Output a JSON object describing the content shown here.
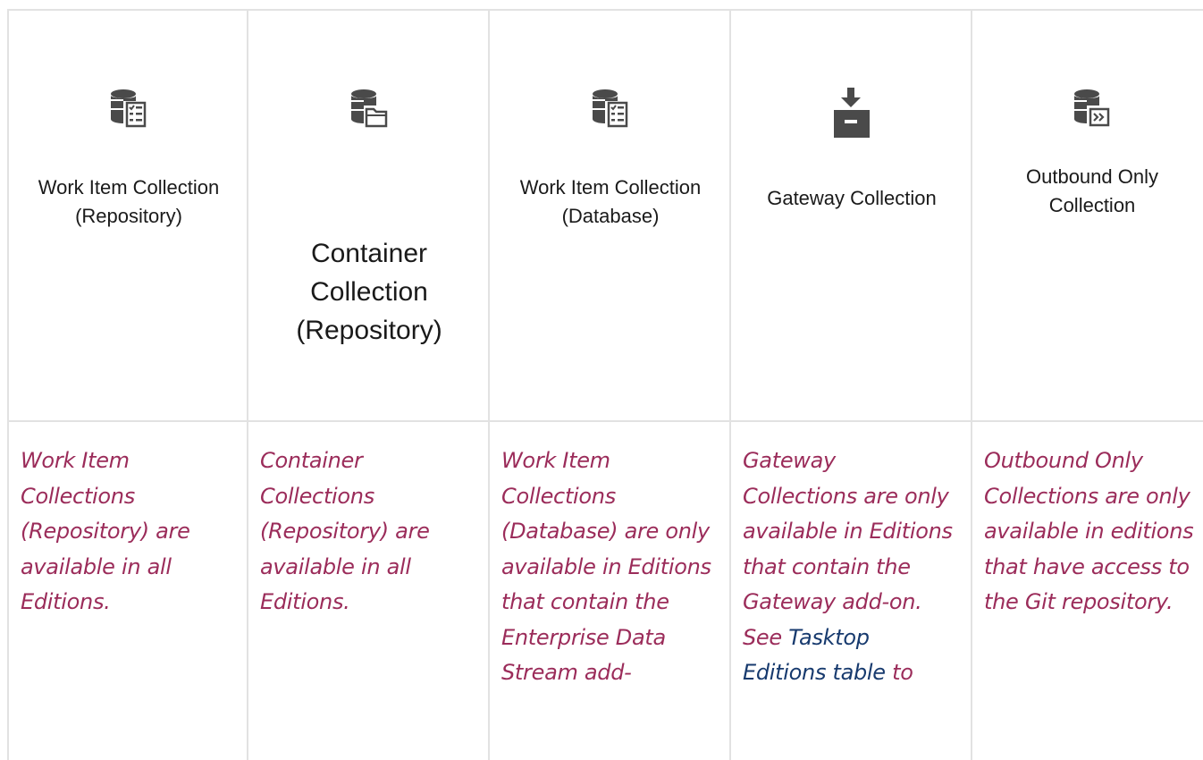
{
  "columns": [
    {
      "icon": "database-checklist-icon",
      "title_lines": [
        "Work Item Collection",
        "(Repository)"
      ],
      "note": "Work Item Collections (Repository) are available in all Editions."
    },
    {
      "icon": "database-folder-icon",
      "title_lines": [
        "Container",
        "Collection",
        "(Repository)"
      ],
      "note": "Container Collections (Repository) are available in all Editions."
    },
    {
      "icon": "database-checklist-icon",
      "title_lines": [
        "Work Item Collection",
        "(Database)"
      ],
      "note": "Work Item Collections (Database) are only available in Editions that contain the Enterprise Data Stream add-"
    },
    {
      "icon": "download-box-icon",
      "title_lines": [
        "Gateway Collection"
      ],
      "note_pre": "Gateway Collections are only available in Editions that contain the Gateway add-on.  See ",
      "note_link": "Tasktop Editions table",
      "note_post": " to"
    },
    {
      "icon": "database-forward-icon",
      "title_lines": [
        "Outbound Only",
        "Collection"
      ],
      "note": "Outbound Only Collections are only available in editions that have access to the Git repository."
    }
  ],
  "colors": {
    "note_text": "#9b2c5a",
    "link_text": "#173a6e",
    "icon": "#4a4a4a",
    "border": "#e2e2e2"
  }
}
